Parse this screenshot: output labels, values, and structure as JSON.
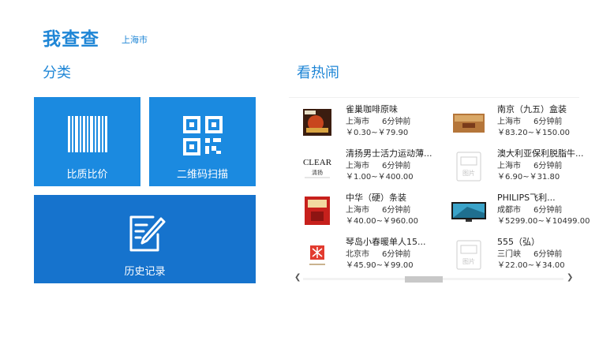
{
  "app": {
    "title": "我查查",
    "city": "上海市"
  },
  "sections": {
    "categories": "分类",
    "hot": "看热闹"
  },
  "tiles": {
    "compare": {
      "label": "比质比价",
      "icon": "barcode-icon"
    },
    "qrscan": {
      "label": "二维码扫描",
      "icon": "qr-code-icon"
    },
    "history": {
      "label": "历史记录",
      "icon": "edit-note-icon"
    }
  },
  "hot_items": [
    {
      "name": "雀巢咖啡原味",
      "location": "上海市",
      "time": "6分钟前",
      "price": "￥0.30~￥79.90"
    },
    {
      "name": "南京（九五）盒装",
      "location": "上海市",
      "time": "6分钟前",
      "price": "￥83.20~￥150.00"
    },
    {
      "name": "清扬男士活力运动薄...",
      "location": "上海市",
      "time": "6分钟前",
      "price": "￥1.00~￥400.00"
    },
    {
      "name": "澳大利亚保利脱脂牛...",
      "location": "上海市",
      "time": "6分钟前",
      "price": "￥6.90~￥31.80"
    },
    {
      "name": "中华（硬）条装",
      "location": "上海市",
      "time": "6分钟前",
      "price": "￥40.00~￥960.00"
    },
    {
      "name": "PHILIPS飞利...",
      "location": "成都市",
      "time": "6分钟前",
      "price": "￥5299.00~￥10499.00"
    },
    {
      "name": "琴岛小春暖单人15...",
      "location": "北京市",
      "time": "6分钟前",
      "price": "￥45.90~￥99.00"
    },
    {
      "name": "555（弘）",
      "location": "三门峡",
      "time": "6分钟前",
      "price": "￥22.00~￥34.00"
    }
  ],
  "thumbs": {
    "clear_logo": "CLEAR",
    "clear_cn": "清扬",
    "placeholder": "图片"
  },
  "colors": {
    "accent": "#1f86d6",
    "tile": "#1b8ae0",
    "tile_dark": "#1673cd"
  }
}
